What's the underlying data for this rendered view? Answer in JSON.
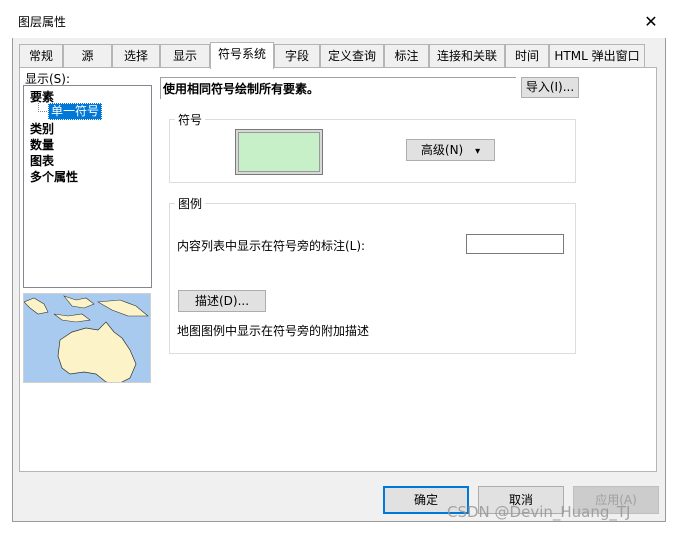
{
  "window": {
    "title": "图层属性",
    "close_glyph": "✕"
  },
  "tabs": [
    "常规",
    "源",
    "选择",
    "显示",
    "符号系统",
    "字段",
    "定义查询",
    "标注",
    "连接和关联",
    "时间",
    "HTML 弹出窗口"
  ],
  "active_tab": "符号系统",
  "show": {
    "label": "显示(S):",
    "tree": {
      "items": [
        "要素",
        "类别",
        "数量",
        "图表",
        "多个属性"
      ],
      "selected_child": "单一符号"
    }
  },
  "symbology": {
    "description": "使用相同符号绘制所有要素。",
    "import_label": "导入(I)...",
    "symbol_group_label": "符号",
    "swatch_color": "#c8f0c8",
    "advanced_label": "高级(N)",
    "advanced_arrow": "▾",
    "legend_group_label": "图例",
    "legend_label_text": "内容列表中显示在符号旁的标注(L):",
    "legend_label_value": "",
    "description_button": "描述(D)...",
    "map_legend_text": "地图图例中显示在符号旁的附加描述"
  },
  "buttons": {
    "ok": "确定",
    "cancel": "取消",
    "apply": "应用(A)"
  },
  "watermark": "CSDN @Devin_Huang_TJ"
}
